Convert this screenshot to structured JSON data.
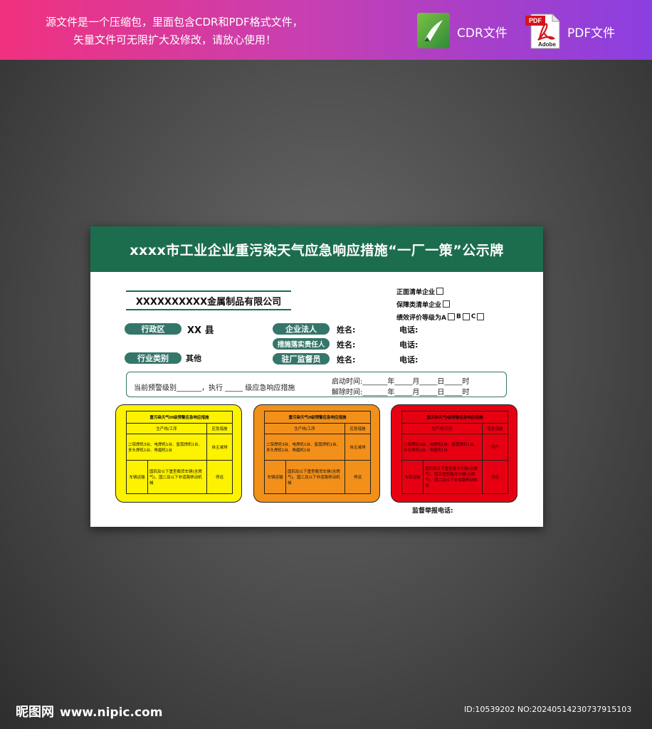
{
  "banner": {
    "line1": "源文件是一个压缩包，里面包含CDR和PDF格式文件，",
    "line2": "矢量文件可无限扩大及修改，请放心使用！",
    "cdr_label": "CDR文件",
    "pdf_label": "PDF文件",
    "pdf_tag": "PDF",
    "adobe_tag": "Adobe"
  },
  "board": {
    "title": "xxxx市工业企业重污染天气应急响应措施“一厂一策”公示牌",
    "company": "XXXXXXXXXX金属制品有限公司",
    "checks": {
      "item1": "正面清单企业",
      "item2": "保障类清单企业",
      "item3_prefix": "绩效评价等级为A",
      "item3_b": "B",
      "item3_c": "C"
    },
    "district_label": "行政区",
    "district_value": "XX 县",
    "industry_label": "行业类别",
    "industry_value": "其他",
    "legal_label": "企业法人",
    "measure_label": "措施落实责任人",
    "supervisor_label": "驻厂监督员",
    "name_label": "姓名:",
    "phone_label": "电话:",
    "warning": {
      "text": "当前预警级别_______，执行 _____ 级应急响应措施",
      "start": "启动时间:_______年_____月_____日_____时",
      "end": "解除时间:_______年_____月_____日_____时"
    },
    "cards": [
      {
        "title": "重污染天气III级预警应急响应措施",
        "col1": "生产线/工序",
        "col2": "应急措施",
        "row1_left": "二保焊机3台、电焊机1台、氩弧焊机1台、多头焊机1台、角磨机1台",
        "row1_right": "自主减排",
        "row2_head": "车辆运输",
        "row2_mid": "国四及以下重型载货车辆(含燃气)、国二及以下非道路移动机械",
        "row2_right": "停运"
      },
      {
        "title": "重污染天气II级预警应急响应措施",
        "col1": "生产线/工序",
        "col2": "应急措施",
        "row1_left": "二保焊机3台、电焊机1台、氩弧焊机1台、多头焊机1台、角磨机1台",
        "row1_right": "自主减排",
        "row2_head": "车辆运输",
        "row2_mid": "国四及以下重型载货车辆(含燃气)、国二及以下非道路移动机械",
        "row2_right": "停运"
      },
      {
        "title": "重污染天气I级预警应急响应措施",
        "col1": "生产线/工序",
        "col2": "应急措施",
        "row1_left": "二保焊机3台、电焊机1台、氩弧焊机1台、多头焊机1台、角磨机1台",
        "row1_right": "停产",
        "row2_head": "车辆运输",
        "row2_mid": "国四及以下重型载货车辆(含燃气)、国五重型载货车辆(含燃气)、国二及以下非道路移动机械",
        "row2_right": "停运"
      }
    ],
    "supervise_phone": "监督举报电话:"
  },
  "footer": {
    "logo": "昵图网",
    "url": "www.nipic.com",
    "id": "ID:10539202 NO:20240514230737915103"
  },
  "colors": {
    "header_green": "#1c6d4e",
    "pill_green": "#35766a",
    "yellow": "#fdf200",
    "orange": "#f39019",
    "red": "#e60012"
  }
}
